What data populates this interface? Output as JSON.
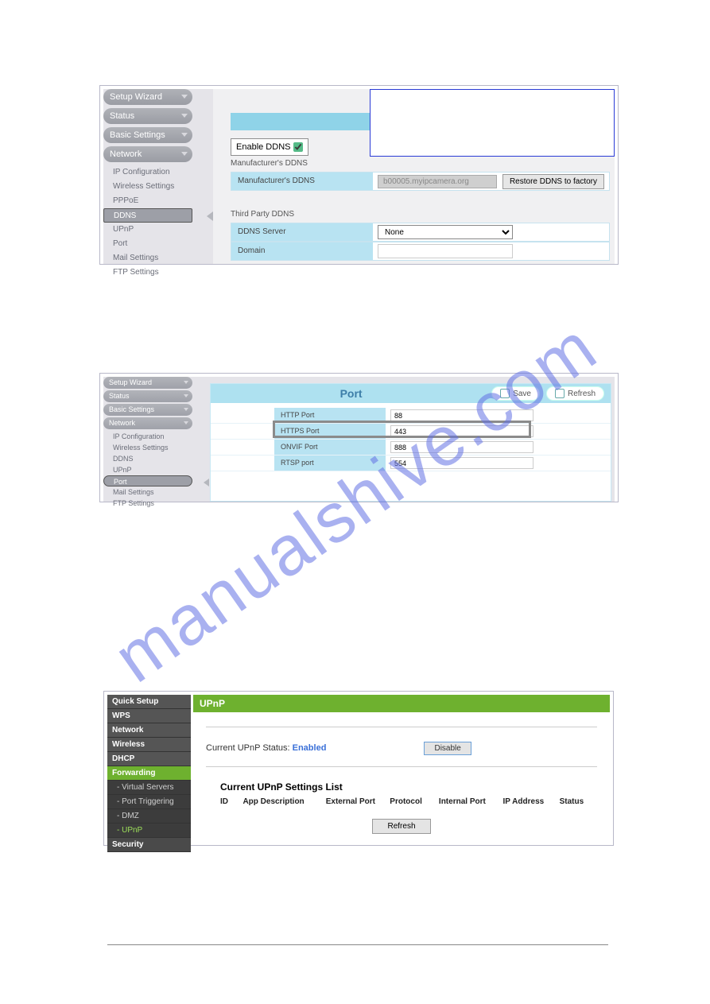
{
  "watermark": "manualshive.com",
  "panel1": {
    "nav_major": [
      "Setup Wizard",
      "Status",
      "Basic Settings",
      "Network"
    ],
    "nav_sub": [
      "IP Configuration",
      "Wireless Settings",
      "PPPoE",
      "DDNS",
      "UPnP",
      "Port",
      "Mail Settings",
      "FTP Settings"
    ],
    "nav_selected": "DDNS",
    "enable_label": "Enable DDNS",
    "mfg_section": "Manufacturer's DDNS",
    "mfg_row_label": "Manufacturer's DDNS",
    "mfg_value": "b00005.myipcamera.org",
    "restore_btn": "Restore DDNS to factory",
    "third_section": "Third Party DDNS",
    "server_label": "DDNS Server",
    "server_value": "None",
    "domain_label": "Domain",
    "domain_value": ""
  },
  "panel2": {
    "nav_major": [
      "Setup Wizard",
      "Status",
      "Basic Settings",
      "Network"
    ],
    "nav_sub": [
      "IP Configuration",
      "Wireless Settings",
      "DDNS",
      "UPnP",
      "Port",
      "Mail Settings",
      "FTP Settings"
    ],
    "nav_selected": "Port",
    "title": "Port",
    "save": "Save",
    "refresh": "Refresh",
    "rows": {
      "http": {
        "label": "HTTP Port",
        "value": "88"
      },
      "https": {
        "label": "HTTPS Port",
        "value": "443"
      },
      "onvif": {
        "label": "ONVIF Port",
        "value": "888"
      },
      "rtsp": {
        "label": "RTSP port",
        "value": "554"
      }
    }
  },
  "panel3": {
    "nav": {
      "quick": "Quick Setup",
      "wps": "WPS",
      "network": "Network",
      "wireless": "Wireless",
      "dhcp": "DHCP",
      "forwarding": "Forwarding",
      "virt": "- Virtual Servers",
      "ptrig": "- Port Triggering",
      "dmz": "- DMZ",
      "upnp": "- UPnP",
      "security": "Security"
    },
    "title": "UPnP",
    "status_label": "Current UPnP Status: ",
    "status_value": "Enabled",
    "disable_btn": "Disable",
    "list_title": "Current UPnP Settings List",
    "cols": {
      "id": "ID",
      "app": "App Description",
      "ext": "External Port",
      "proto": "Protocol",
      "intp": "Internal Port",
      "ip": "IP Address",
      "status": "Status"
    },
    "refresh_btn": "Refresh"
  }
}
